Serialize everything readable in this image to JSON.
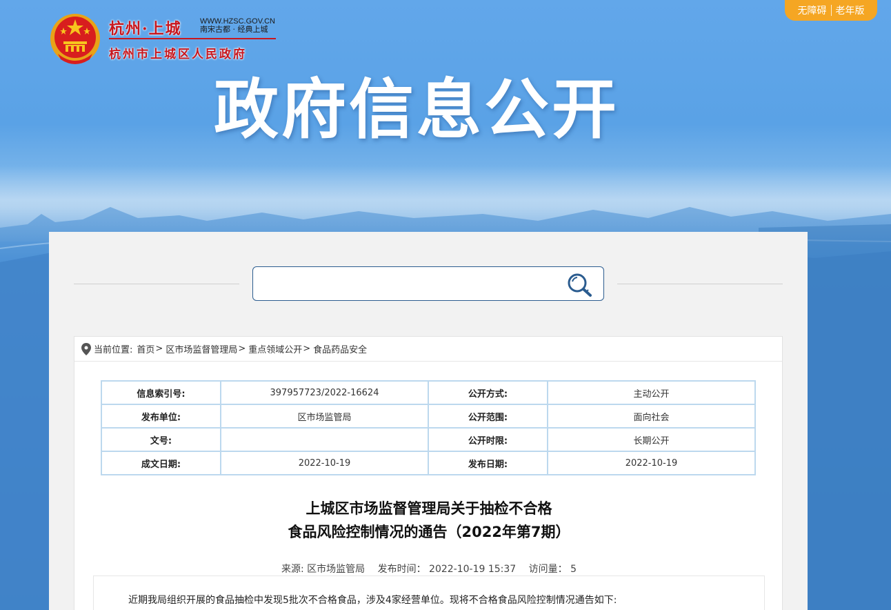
{
  "header": {
    "brand_title": "杭州·上城",
    "brand_url": "WWW.HZSC.GOV.CN",
    "brand_slogan": "南宋古都 · 经典上城",
    "brand_subtitle": "杭州市上城区人民政府",
    "accessibility_label": "无障碍",
    "elder_mode_label": "老年版",
    "banner_title": "政府信息公开"
  },
  "search": {
    "value": "",
    "placeholder": ""
  },
  "breadcrumb": {
    "prefix": "当前位置:",
    "items": [
      "首页",
      "区市场监督管理局",
      "重点领域公开",
      "食品药品安全"
    ],
    "separator": ">"
  },
  "meta_table": {
    "rows": [
      {
        "k1": "信息索引号:",
        "v1": "397957723/2022-16624",
        "k2": "公开方式:",
        "v2": "主动公开"
      },
      {
        "k1": "发布单位:",
        "v1": "区市场监管局",
        "k2": "公开范围:",
        "v2": "面向社会"
      },
      {
        "k1": "文号:",
        "v1": "",
        "k2": "公开时限:",
        "v2": "长期公开"
      },
      {
        "k1": "成文日期:",
        "v1": "2022-10-19",
        "k2": "发布日期:",
        "v2": "2022-10-19"
      }
    ]
  },
  "article": {
    "title_line1": "上城区市场监督管理局关于抽检不合格",
    "title_line2": "食品风险控制情况的通告（2022年第7期）",
    "source_label": "来源:",
    "source_value": "区市场监管局",
    "publish_label": "发布时间：",
    "publish_value": "2022-10-19 15:37",
    "views_label": "访问量：",
    "views_value": "5",
    "body_first_line": "近期我局组织开展的食品抽检中发现5批次不合格食品，涉及4家经营单位。现将不合格食品风险控制情况通告如下:"
  },
  "colors": {
    "brand_red": "#c8161d",
    "pill_orange": "#f5a623",
    "table_border": "#bcd8ee",
    "search_border": "#2b5c8f"
  }
}
